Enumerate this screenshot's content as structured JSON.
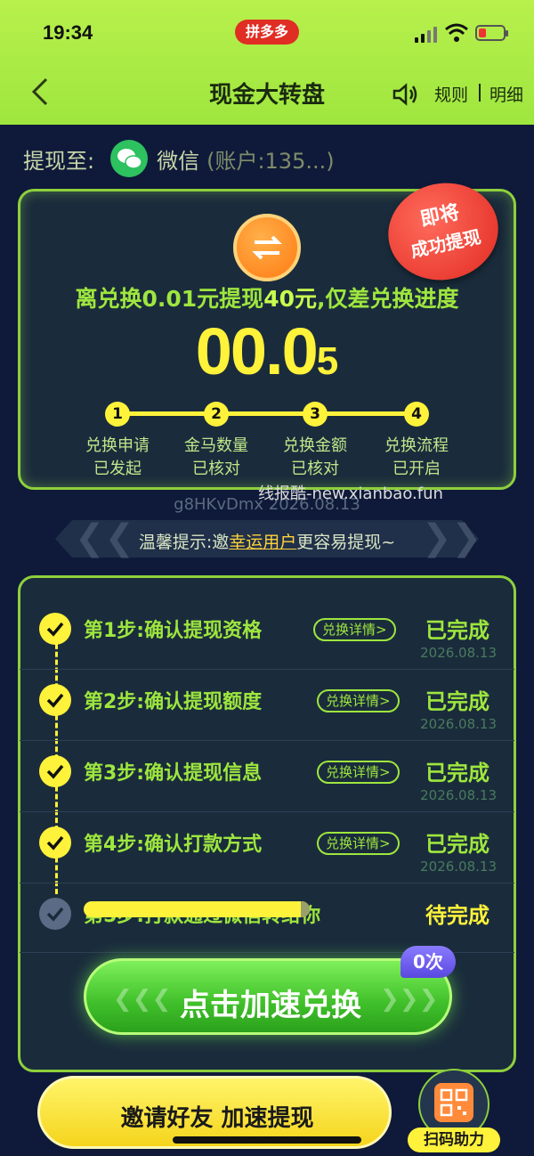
{
  "status": {
    "time": "19:34",
    "app_badge": "拼多多"
  },
  "header": {
    "title": "现金大转盘",
    "rules": "规则",
    "details": "明细"
  },
  "withdraw": {
    "label": "提现至:",
    "method": "微信",
    "account": "(账户:135...)"
  },
  "card": {
    "stamp_line1": "即将",
    "stamp_line2": "成功提现",
    "headline_pre": "离兑换0.01元提现",
    "headline_amount": "40元",
    "headline_post": ",仅差兑换进度",
    "progress_big": "00.0",
    "progress_small": "5",
    "steps": [
      {
        "num": "1",
        "line1": "兑换申请",
        "line2": "已发起"
      },
      {
        "num": "2",
        "line1": "金马数量",
        "line2": "已核对"
      },
      {
        "num": "3",
        "line1": "兑换金额",
        "line2": "已核对"
      },
      {
        "num": "4",
        "line1": "兑换流程",
        "line2": "已开启"
      }
    ]
  },
  "watermark": {
    "id": "g8HKvDmx 2026.08.13",
    "site": "线报酷-new.xianbao.fun"
  },
  "tip": {
    "pre": "温馨提示:邀",
    "highlight": "幸运用户",
    "post": "更容易提现~"
  },
  "process": {
    "steps": [
      {
        "title": "第1步:确认提现资格",
        "link": "兑换详情>",
        "status": "已完成",
        "date": "2026.08.13"
      },
      {
        "title": "第2步:确认提现额度",
        "link": "兑换详情>",
        "status": "已完成",
        "date": "2026.08.13"
      },
      {
        "title": "第3步:确认提现信息",
        "link": "兑换详情>",
        "status": "已完成",
        "date": "2026.08.13"
      },
      {
        "title": "第4步:确认打款方式",
        "link": "兑换详情>",
        "status": "已完成",
        "date": "2026.08.13"
      },
      {
        "title": "第5步:打款通过微信转给你",
        "status": "待完成"
      }
    ],
    "step5_progress": 0.97
  },
  "accelerate": {
    "label": "点击加速兑换",
    "count_badge": "0次"
  },
  "invite": {
    "label": "邀请好友 加速提现"
  },
  "scan": {
    "label": "扫码助力"
  },
  "colors": {
    "accent_green": "#9ee63e",
    "accent_yellow": "#fff23a",
    "bg": "#0f1a3a"
  }
}
